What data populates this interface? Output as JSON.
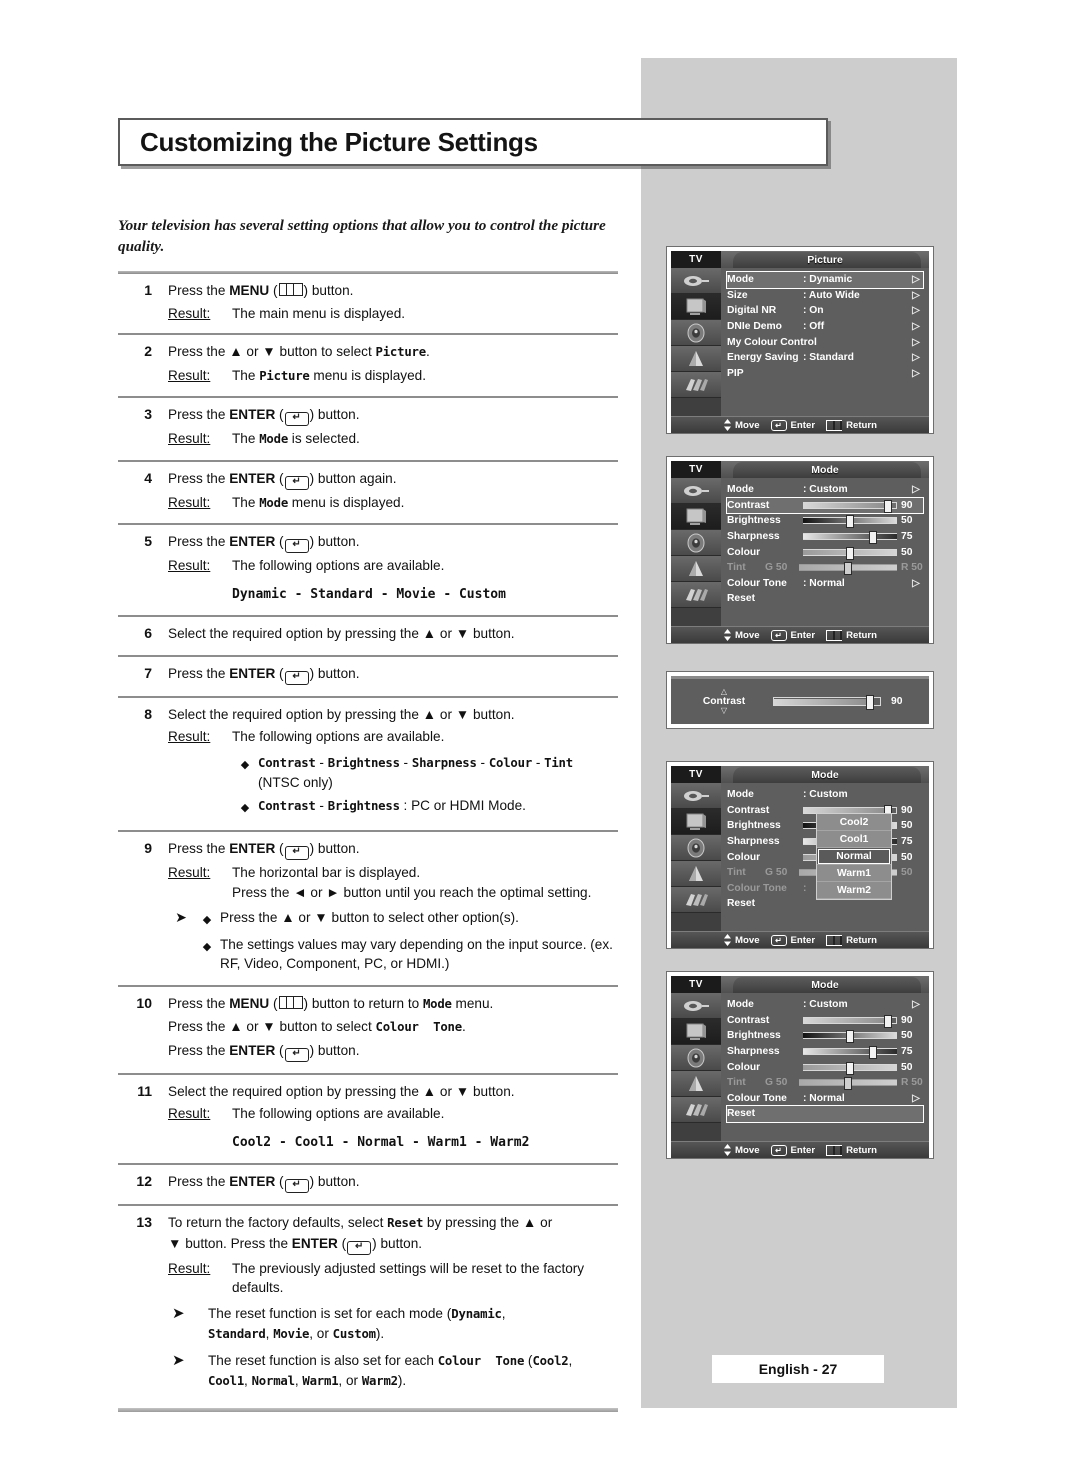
{
  "page": {
    "title": "Customizing the Picture Settings",
    "intro": "Your television has several setting options that allow you to control the picture quality.",
    "footer": "English - 27"
  },
  "steps": [
    {
      "num": "1",
      "lines": [
        "Press the MENU ( ) button."
      ],
      "result_label": "Result:",
      "result": "The main menu is displayed."
    },
    {
      "num": "2",
      "lines": [
        "Press the ▲ or ▼ button to select Picture."
      ],
      "result_label": "Result:",
      "result": "The Picture menu is displayed."
    },
    {
      "num": "3",
      "lines": [
        "Press the ENTER ( ) button."
      ],
      "result_label": "Result:",
      "result": "The Mode is selected."
    },
    {
      "num": "4",
      "lines": [
        "Press the ENTER ( ) button again."
      ],
      "result_label": "Result:",
      "result": "The Mode menu is displayed."
    },
    {
      "num": "5",
      "lines": [
        "Press the ENTER ( ) button."
      ],
      "result_label": "Result:",
      "result": "The following options are available.",
      "options": "Dynamic - Standard - Movie - Custom"
    },
    {
      "num": "6",
      "lines": [
        "Select the required option by pressing the ▲ or ▼ button."
      ]
    },
    {
      "num": "7",
      "lines": [
        "Press the ENTER ( ) button."
      ]
    },
    {
      "num": "8",
      "lines": [
        "Select the required option by pressing the ▲ or ▼ button."
      ],
      "result_label": "Result:",
      "result": "The following options are available.",
      "bullets": [
        "Contrast - Brightness - Sharpness - Colour - Tint (NTSC only)",
        "Contrast - Brightness : PC or HDMI Mode."
      ]
    },
    {
      "num": "9",
      "lines": [
        "Press the ENTER ( ) button."
      ],
      "result_label": "Result:",
      "result": "The horizontal bar is displayed.",
      "result2": "Press the ◄ or ► button until you reach the optimal setting.",
      "notes": [
        "Press the ▲ or ▼ button to select other option(s).",
        "The settings values may vary depending on the input source. (ex. RF, Video, Component, PC, or HDMI.)"
      ]
    },
    {
      "num": "10",
      "lines": [
        "Press the MENU ( ) button to return to Mode menu.",
        "Press the ▲ or ▼ button to select Colour Tone.",
        "Press the ENTER ( ) button."
      ]
    },
    {
      "num": "11",
      "lines": [
        "Select the required option by pressing the ▲ or ▼ button."
      ],
      "result_label": "Result:",
      "result": "The following options are available.",
      "options": "Cool2 - Cool1 - Normal - Warm1 - Warm2"
    },
    {
      "num": "12",
      "lines": [
        "Press the ENTER ( ) button."
      ]
    },
    {
      "num": "13",
      "lines": [
        "To return the factory defaults, select Reset by pressing the ▲ or ▼ button. Press the ENTER ( ) button."
      ],
      "result_label": "Result:",
      "result": "The previously adjusted settings will be reset to the factory defaults.",
      "notes_arrow": [
        "The reset function is set for each mode (Dynamic, Standard, Movie, or Custom).",
        "The reset function is also set for each Colour Tone (Cool2, Cool1, Normal, Warm1, or Warm2)."
      ]
    }
  ],
  "osd_common": {
    "tv_label": "TV",
    "move": "Move",
    "enter": "Enter",
    "return": "Return"
  },
  "osd_picture": {
    "title": "Picture",
    "rows": [
      {
        "name": "Mode",
        "value": ": Dynamic",
        "arrow": "▷",
        "highlight": true
      },
      {
        "name": "Size",
        "value": ": Auto Wide",
        "arrow": "▷"
      },
      {
        "name": "Digital NR",
        "value": ": On",
        "arrow": "▷"
      },
      {
        "name": "DNIe Demo",
        "value": ": Off",
        "arrow": "▷"
      },
      {
        "name": "My Colour Control",
        "value": "",
        "arrow": "▷"
      },
      {
        "name": "Energy Saving",
        "value": ": Standard",
        "arrow": "▷"
      },
      {
        "name": "PIP",
        "value": "",
        "arrow": "▷"
      }
    ]
  },
  "osd_mode_contrast": {
    "title": "Mode",
    "rows": [
      {
        "name": "Mode",
        "value": ": Custom",
        "arrow": "▷"
      },
      {
        "name": "Contrast",
        "slider": 90,
        "num": "90",
        "highlight": true
      },
      {
        "name": "Brightness",
        "slider": 50,
        "num": "50"
      },
      {
        "name": "Sharpness",
        "slider": 75,
        "num": "75"
      },
      {
        "name": "Colour",
        "slider": 50,
        "num": "50"
      },
      {
        "name": "Tint",
        "prefix": "G 50",
        "slider": 50,
        "num": "R 50",
        "dim": true
      },
      {
        "name": "Colour Tone",
        "value": ": Normal",
        "arrow": "▷"
      },
      {
        "name": "Reset",
        "value": "",
        "arrow": ""
      }
    ]
  },
  "osd_contrast_bar": {
    "label": "Contrast",
    "value": "90",
    "slider": 90
  },
  "osd_mode_tone": {
    "title": "Mode",
    "rows": [
      {
        "name": "Mode",
        "value": ": Custom",
        "arrow": ""
      },
      {
        "name": "Contrast",
        "slider": 90,
        "num": "90"
      },
      {
        "name": "Brightness",
        "slider": 50,
        "num": "50"
      },
      {
        "name": "Sharpness",
        "slider": 75,
        "num": "75"
      },
      {
        "name": "Colour",
        "slider": 50,
        "num": "50"
      },
      {
        "name": "Tint",
        "prefix": "G 50",
        "slider": 50,
        "num": "50",
        "dim": true
      },
      {
        "name": "Colour Tone",
        "value": ":",
        "arrow": ""
      },
      {
        "name": "Reset",
        "value": "",
        "arrow": ""
      }
    ],
    "dropdown": [
      "Cool2",
      "Cool1",
      "Normal",
      "Warm1",
      "Warm2"
    ],
    "dropdown_selected": "Normal"
  },
  "osd_mode_reset": {
    "title": "Mode",
    "rows": [
      {
        "name": "Mode",
        "value": ": Custom",
        "arrow": "▷"
      },
      {
        "name": "Contrast",
        "slider": 90,
        "num": "90"
      },
      {
        "name": "Brightness",
        "slider": 50,
        "num": "50"
      },
      {
        "name": "Sharpness",
        "slider": 75,
        "num": "75"
      },
      {
        "name": "Colour",
        "slider": 50,
        "num": "50"
      },
      {
        "name": "Tint",
        "prefix": "G 50",
        "slider": 50,
        "num": "R 50",
        "dim": true
      },
      {
        "name": "Colour Tone",
        "value": ": Normal",
        "arrow": "▷"
      },
      {
        "name": "Reset",
        "value": "",
        "arrow": "",
        "highlight": true
      }
    ]
  }
}
